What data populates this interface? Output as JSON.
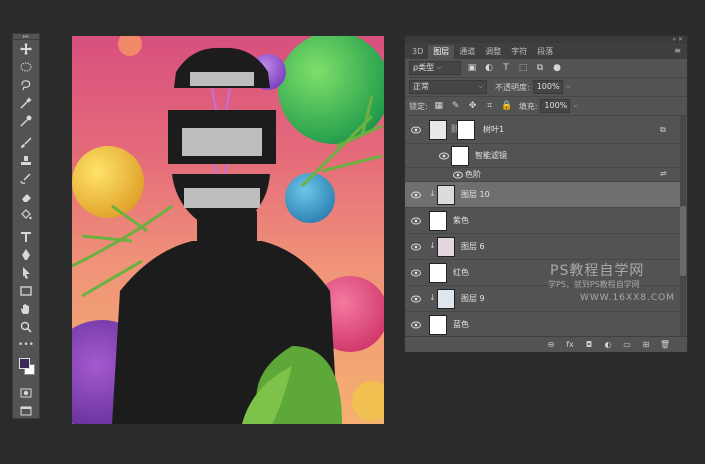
{
  "toolbar": {
    "grip": "▸▸",
    "tools": [
      "move-icon",
      "marquee-icon",
      "lasso-icon",
      "magic-wand-icon",
      "eyedropper-icon",
      "brush-icon",
      "stamp-icon",
      "eraser-icon",
      "paint-bucket-icon",
      "type-icon",
      "pen-icon",
      "path-select-icon",
      "rectangle-icon",
      "hand-icon",
      "zoom-icon"
    ],
    "more": "•••",
    "fg_color": "#3a2a55",
    "bg_color": "#ffffff"
  },
  "panel": {
    "close": "»  ✕",
    "tabs": [
      "3D",
      "图层",
      "通道",
      "调整",
      "字符",
      "段落"
    ],
    "active_tab": "图层",
    "menu": "≡",
    "filter": {
      "value": "ρ类型",
      "dropdown": "⌵"
    },
    "blend": {
      "value": "正常",
      "dropdown": "⌵"
    },
    "opacity_label": "不透明度:",
    "opacity_value": "100%",
    "lock_label": "锁定:",
    "fill_label": "填充:",
    "fill_value": "100%",
    "layers": [
      {
        "name": "树叶1"
      },
      {
        "name": "智能滤镜"
      },
      {
        "name": "色阶"
      },
      {
        "name": "图层 10"
      },
      {
        "name": "紫色"
      },
      {
        "name": "图层 6"
      },
      {
        "name": "红色"
      },
      {
        "name": "图层 9"
      },
      {
        "name": "蓝色"
      }
    ],
    "bottom_icons": [
      "⊖",
      "fx",
      "◘",
      "◐",
      "▭",
      "⊞",
      "🗑"
    ]
  },
  "watermark": {
    "line1": "PS教程自学网",
    "line2": "学PS，就到PS教程自学网",
    "line3": "WWW.16XX8.COM"
  },
  "colors": {
    "background": "#2b2b2b",
    "panel": "#535353",
    "selected_layer": "#6f6f6f"
  }
}
